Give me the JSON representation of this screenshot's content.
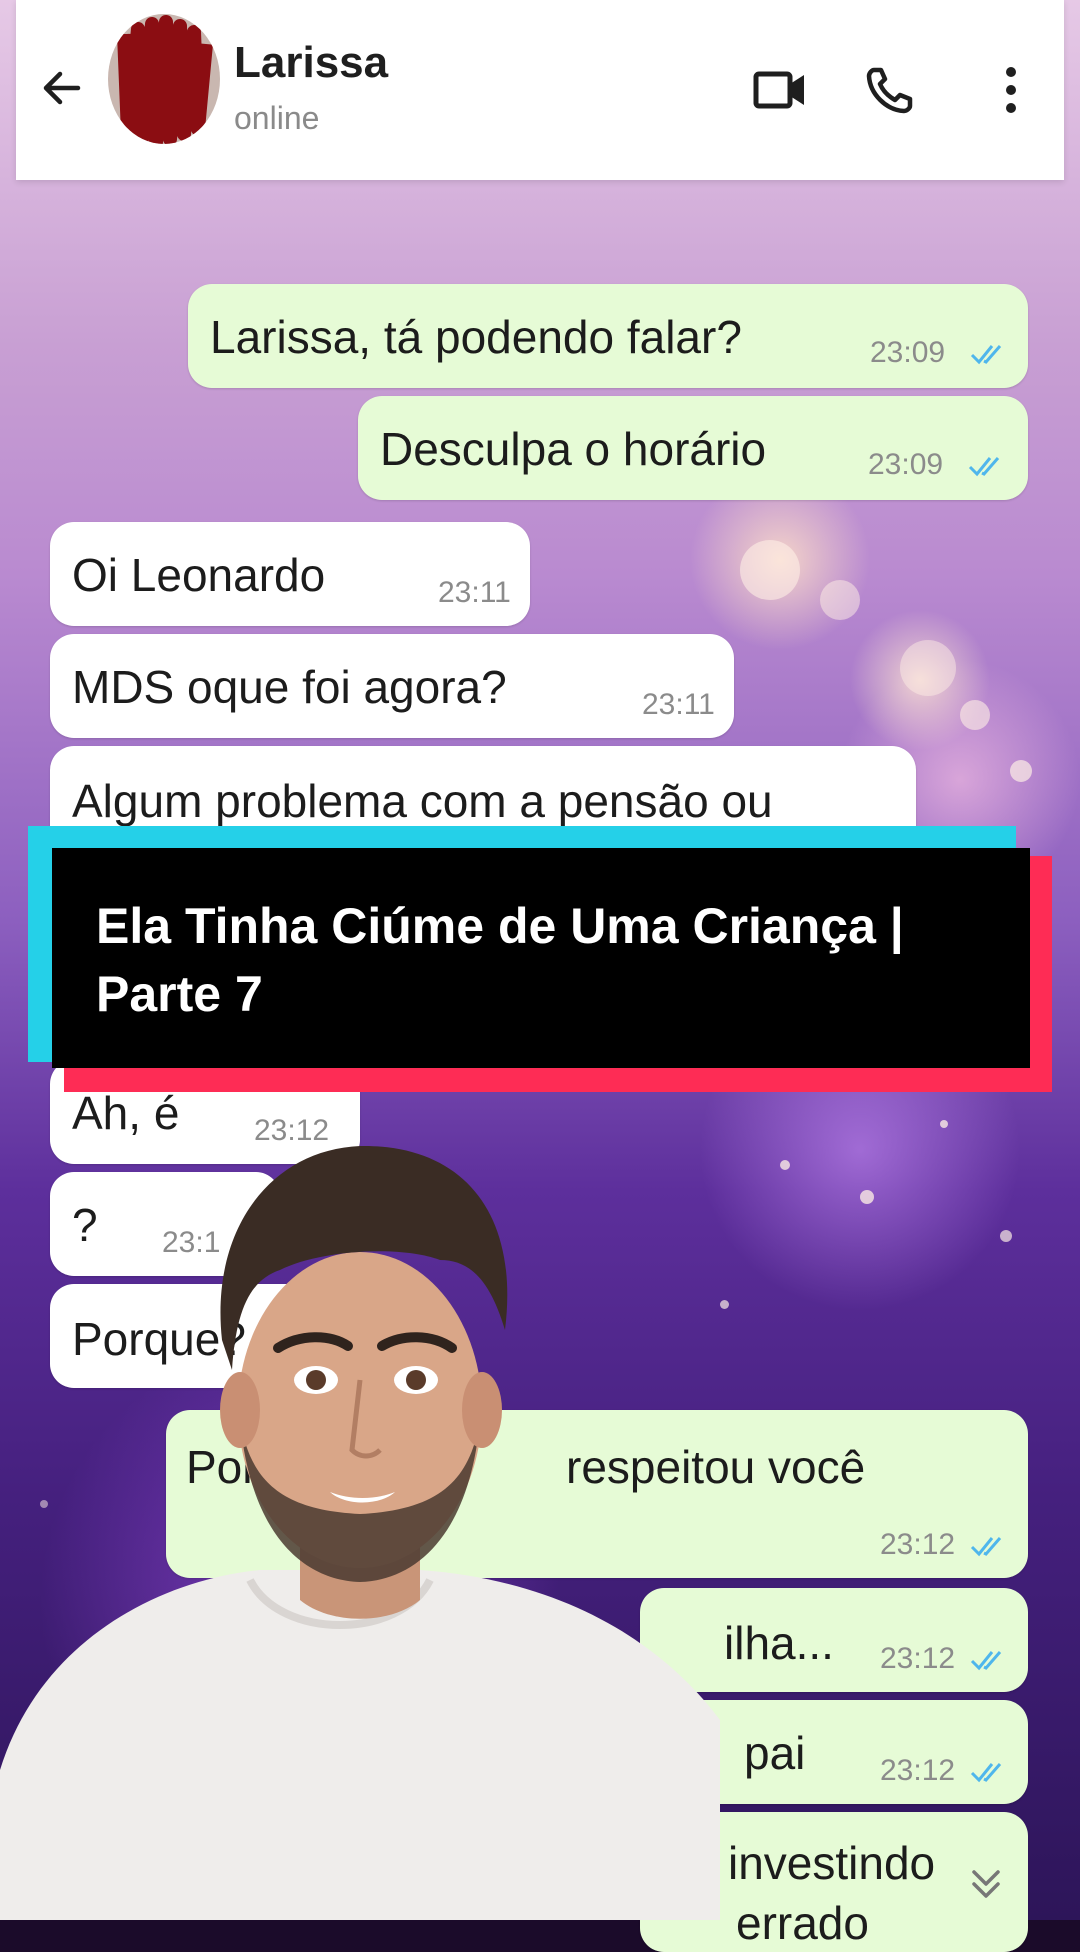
{
  "header": {
    "contact_name": "Larissa",
    "status": "online"
  },
  "messages": [
    {
      "direction": "out",
      "text": "Larissa, tá podendo falar?",
      "time": "23:09",
      "read": true
    },
    {
      "direction": "out",
      "text": "Desculpa o horário",
      "time": "23:09",
      "read": true
    },
    {
      "direction": "in",
      "text": "Oi Leonardo",
      "time": "23:11"
    },
    {
      "direction": "in",
      "text": "MDS oque foi agora?",
      "time": "23:11"
    },
    {
      "direction": "in",
      "text": "Algum problema com a pensão ou",
      "time": ""
    },
    {
      "direction": "in",
      "text": "Ah, é",
      "time": "23:12"
    },
    {
      "direction": "in",
      "text": "?",
      "time": "23:1"
    },
    {
      "direction": "in",
      "text": "Porque?",
      "time": ""
    },
    {
      "direction": "out",
      "text": "Por",
      "text2": "respeitou você",
      "time": "23:12",
      "read": true
    },
    {
      "direction": "out",
      "text": "ilha...",
      "time": "23:12",
      "read": true
    },
    {
      "direction": "out",
      "text": "pai",
      "time": "23:12",
      "read": true
    },
    {
      "direction": "out",
      "text": "investindo",
      "text2": "errado",
      "time": ""
    }
  ],
  "banner": {
    "line1": "Ela Tinha Ciúme de Uma Criança |",
    "line2": "Parte 7"
  },
  "colors": {
    "outgoing_bubble": "#e6fbd6",
    "incoming_bubble": "#ffffff",
    "read_tick": "#4fb6ec",
    "banner_red": "#fe2c55",
    "banner_cyan": "#25d0e8"
  },
  "icons": [
    "back-arrow-icon",
    "video-call-icon",
    "phone-icon",
    "more-options-icon",
    "double-check-icon",
    "scroll-down-icon"
  ]
}
